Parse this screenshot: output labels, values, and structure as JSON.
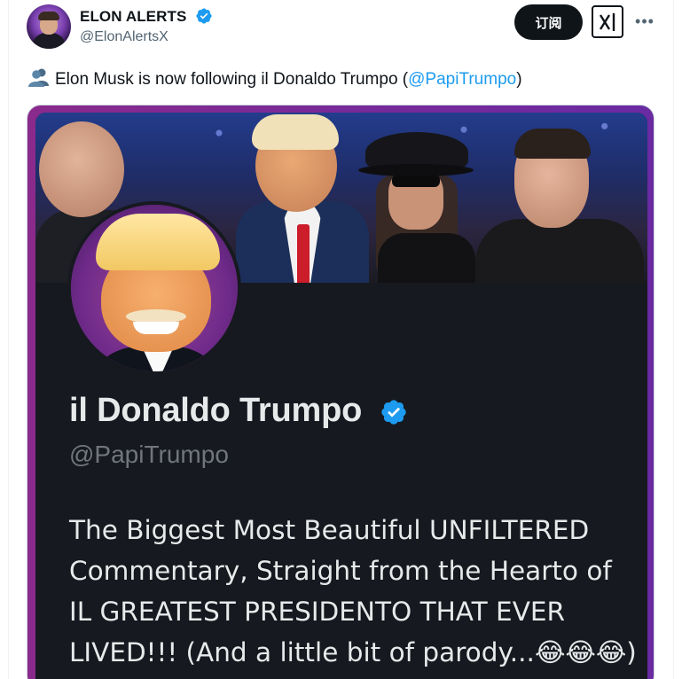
{
  "tweet": {
    "author_name": "ELON ALERTS",
    "author_handle": "@ElonAlertsX",
    "subscribe_label": "订阅",
    "text_before": "Elon Musk is now following il Donaldo Trumpo (",
    "mention": "@PapiTrumpo",
    "text_after": ")",
    "lead_icon": "busts-in-silhouette-icon"
  },
  "card": {
    "profile_name": "il Donaldo Trumpo",
    "profile_handle": "@PapiTrumpo",
    "bio": "The Biggest Most Beautiful UNFILTERED Commentary, Straight from the Hearto of IL GREATEST PRESIDENTO THAT EVER LIVED!!! (And a little bit of parody...😂😂😂)"
  },
  "colors": {
    "accent": "#1d9bf0",
    "card_border": "#8a2a8c",
    "card_bg": "#16191f",
    "verified": "#1d9bf0"
  }
}
